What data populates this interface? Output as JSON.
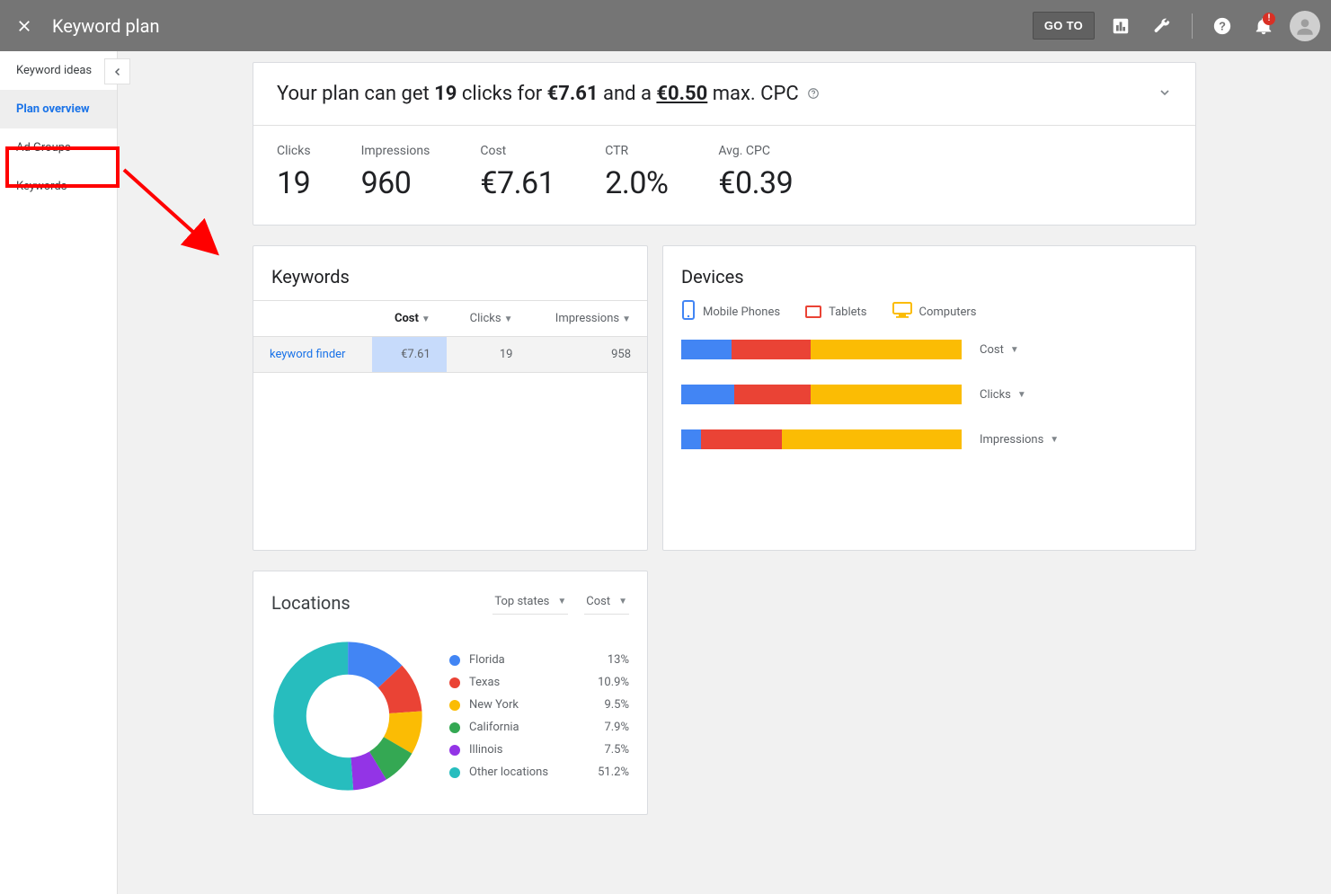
{
  "header": {
    "title": "Keyword plan",
    "goto_label": "GO TO",
    "alert_badge": "!"
  },
  "sidebar": {
    "items": [
      {
        "label": "Keyword ideas",
        "active": false
      },
      {
        "label": "Plan overview",
        "active": true
      },
      {
        "label": "Ad Groups",
        "active": false
      },
      {
        "label": "Keywords",
        "active": false
      }
    ]
  },
  "summary": {
    "prefix": "Your plan can get ",
    "clicks": "19",
    "mid1": " clicks for ",
    "cost": "€7.61",
    "mid2": " and a ",
    "maxcpc": "€0.50",
    "suffix": " max. CPC",
    "help": "?"
  },
  "metrics": [
    {
      "label": "Clicks",
      "value": "19"
    },
    {
      "label": "Impressions",
      "value": "960"
    },
    {
      "label": "Cost",
      "value": "€7.61"
    },
    {
      "label": "CTR",
      "value": "2.0%"
    },
    {
      "label": "Avg. CPC",
      "value": "€0.39"
    }
  ],
  "keywords": {
    "title": "Keywords",
    "columns": {
      "cost": "Cost",
      "clicks": "Clicks",
      "impressions": "Impressions"
    },
    "rows": [
      {
        "name": "keyword finder",
        "cost": "€7.61",
        "clicks": "19",
        "impressions": "958"
      }
    ]
  },
  "devices": {
    "title": "Devices",
    "legend": {
      "mobile": "Mobile Phones",
      "tablets": "Tablets",
      "computers": "Computers"
    },
    "metric_labels": {
      "cost": "Cost",
      "clicks": "Clicks",
      "impressions": "Impressions"
    },
    "colors": {
      "mobile": "#4285f4",
      "tablets": "#ea4335",
      "computers": "#fbbc04"
    }
  },
  "locations": {
    "title": "Locations",
    "selectors": {
      "dim": "Top states",
      "metric": "Cost"
    }
  },
  "chart_data": [
    {
      "id": "devices_stacked",
      "type": "bar",
      "orientation": "horizontal-stacked",
      "categories": [
        "Cost",
        "Clicks",
        "Impressions"
      ],
      "series": [
        {
          "name": "Mobile Phones",
          "values": [
            18,
            19,
            7
          ]
        },
        {
          "name": "Tablets",
          "values": [
            28,
            27,
            29
          ]
        },
        {
          "name": "Computers",
          "values": [
            54,
            54,
            64
          ]
        }
      ],
      "unit": "percent",
      "xlim": [
        0,
        100
      ]
    },
    {
      "id": "locations_donut",
      "type": "pie",
      "title": "Locations",
      "categories": [
        "Florida",
        "Texas",
        "New York",
        "California",
        "Illinois",
        "Other locations"
      ],
      "values": [
        13,
        10.9,
        9.5,
        7.9,
        7.5,
        51.2
      ],
      "unit": "percent",
      "colors": [
        "#4285f4",
        "#ea4335",
        "#fbbc04",
        "#34a853",
        "#9334e6",
        "#27bdbe"
      ]
    }
  ]
}
